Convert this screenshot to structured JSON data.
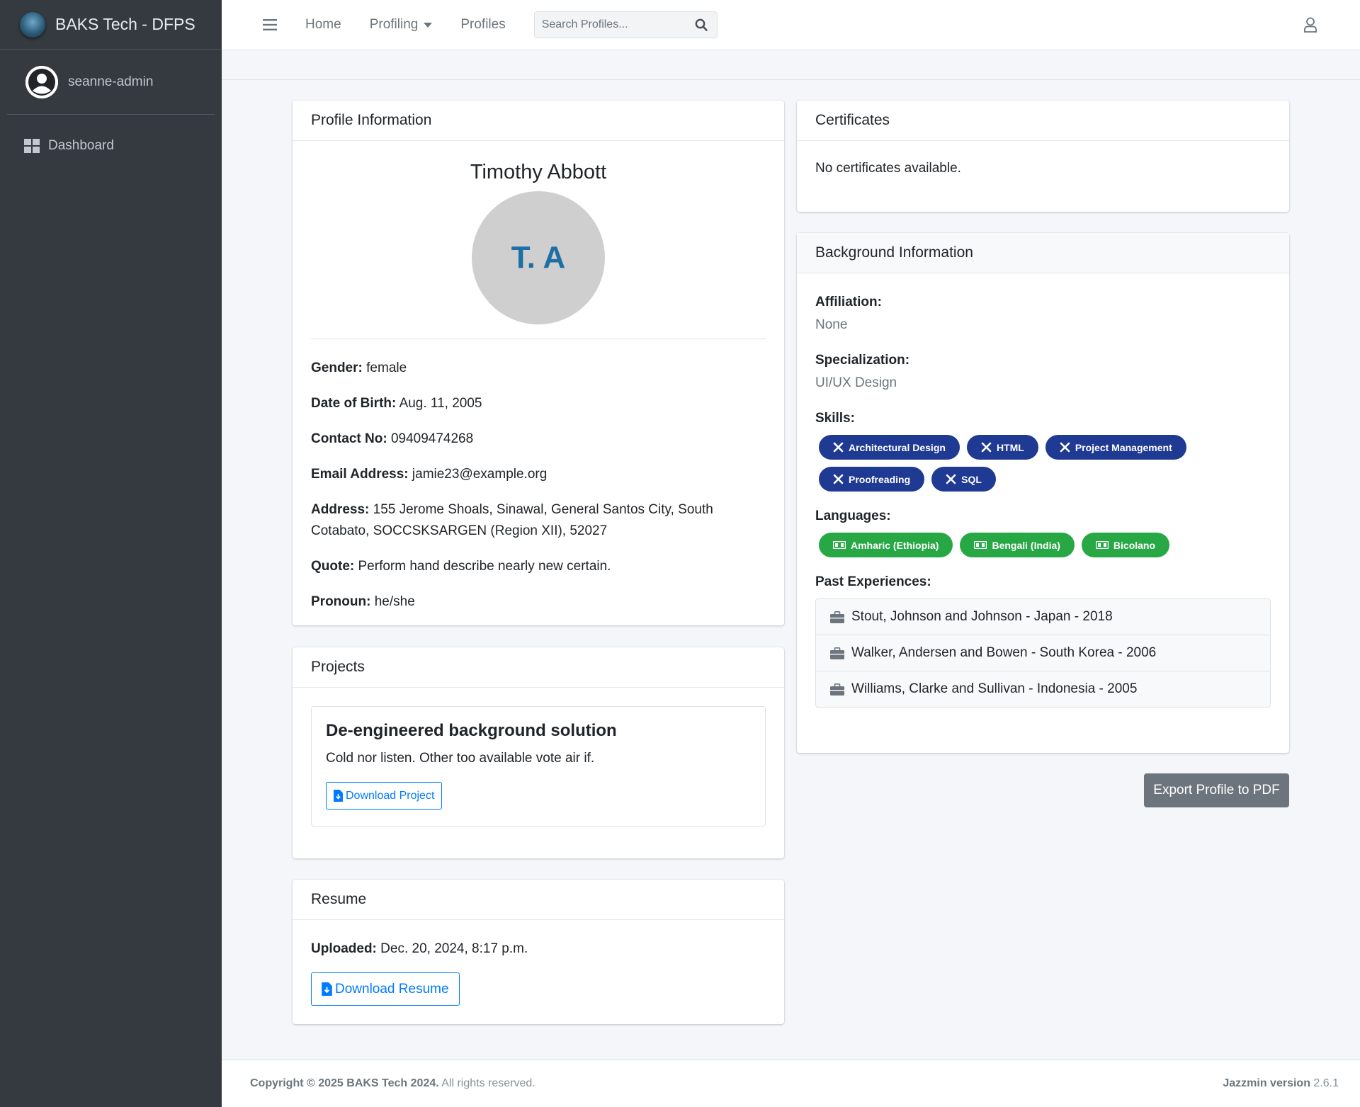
{
  "brand": {
    "title": "BAKS Tech - DFPS"
  },
  "sidebar": {
    "user": "seanne-admin",
    "items": [
      {
        "label": "Dashboard",
        "icon": "dashboard-icon"
      }
    ]
  },
  "navbar": {
    "links": {
      "home": "Home",
      "profiling": "Profiling",
      "profiles": "Profiles"
    },
    "search_placeholder": "Search Profiles..."
  },
  "profile_card": {
    "header": "Profile Information",
    "name": "Timothy Abbott",
    "initials": "T. A",
    "fields": [
      {
        "label": "Gender:",
        "value": "female"
      },
      {
        "label": "Date of Birth:",
        "value": "Aug. 11, 2005"
      },
      {
        "label": "Contact No:",
        "value": "09409474268"
      },
      {
        "label": "Email Address:",
        "value": "jamie23@example.org"
      },
      {
        "label": "Address:",
        "value": "155 Jerome Shoals, Sinawal, General Santos City, South Cotabato, SOCCSKSARGEN (Region XII), 52027"
      },
      {
        "label": "Quote:",
        "value": "Perform hand describe nearly new certain."
      },
      {
        "label": "Pronoun:",
        "value": "he/she"
      }
    ]
  },
  "projects_card": {
    "header": "Projects",
    "project": {
      "title": "De-engineered background solution",
      "description": "Cold nor listen. Other too available vote air if.",
      "button": "Download Project"
    }
  },
  "resume_card": {
    "header": "Resume",
    "uploaded_label": "Uploaded:",
    "uploaded_value": "Dec. 20, 2024, 8:17 p.m.",
    "button": "Download Resume"
  },
  "certificates_card": {
    "header": "Certificates",
    "empty_text": "No certificates available."
  },
  "background_card": {
    "header": "Background Information",
    "affiliation_label": "Affiliation:",
    "affiliation_value": "None",
    "specialization_label": "Specialization:",
    "specialization_value": "UI/UX Design",
    "skills_label": "Skills:",
    "skills": [
      "Architectural Design",
      "HTML",
      "Project Management",
      "Proofreading",
      "SQL"
    ],
    "languages_label": "Languages:",
    "languages": [
      "Amharic (Ethiopia)",
      "Bengali (India)",
      "Bicolano"
    ],
    "experiences_label": "Past Experiences:",
    "experiences": [
      "Stout, Johnson and Johnson - Japan - 2018",
      "Walker, Andersen and Bowen - South Korea - 2006",
      "Williams, Clarke and Sullivan - Indonesia - 2005"
    ]
  },
  "export_button": "Export Profile to PDF",
  "footer": {
    "copyright_bold": "Copyright © 2025 BAKS Tech 2024.",
    "copyright_rest": " All rights reserved.",
    "version_label": "Jazzmin version",
    "version_value": " 2.6.1"
  },
  "colors": {
    "sidebar": "#343a40",
    "skill_badge": "#1f3a93",
    "language_badge": "#28a745",
    "primary": "#007bff",
    "export": "#6c757d"
  }
}
